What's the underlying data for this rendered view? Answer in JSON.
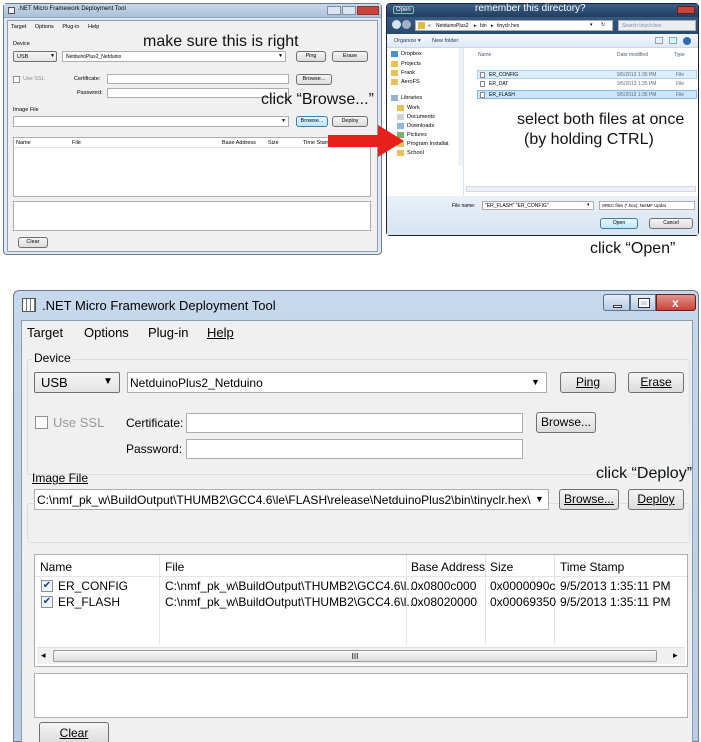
{
  "small_tool": {
    "title": ".NET Micro Framework Deployment Tool",
    "menu": [
      "Target",
      "Options",
      "Plug-in",
      "Help"
    ],
    "device_label": "Device",
    "transport": "USB",
    "device": "NetduinoPlus2_Netduino",
    "ping": "Ping",
    "erase": "Erase",
    "use_ssl": "Use SSL",
    "certificate_label": "Certificate:",
    "password_label": "Password:",
    "browse": "Browse...",
    "image_file_label": "Image File",
    "deploy": "Deploy",
    "columns": [
      "Name",
      "File",
      "Base Address",
      "Size",
      "Time Stamp"
    ],
    "clear": "Clear"
  },
  "open_dialog": {
    "title": "Open",
    "breadcrumb": [
      "NetduinoPlus2",
      "bin",
      "tinyclr.hex"
    ],
    "search_placeholder": "Search tinyclr.hex",
    "organize": "Organize ▾",
    "new_folder": "New folder",
    "nav_items": [
      "Dropbox",
      "Projects",
      "Frank",
      "AeroFS",
      "Libraries",
      "Work",
      "Documents",
      "Downloads",
      "Pictures",
      "Program Installat",
      "School"
    ],
    "columns": [
      "Name",
      "Date modified",
      "Type"
    ],
    "files": [
      {
        "name": "ER_CONFIG",
        "date": "9/5/2013 1:35 PM",
        "type": "File"
      },
      {
        "name": "ER_DAT",
        "date": "9/5/2013 1:35 PM",
        "type": "File"
      },
      {
        "name": "ER_FLASH",
        "date": "9/5/2013 1:35 PM",
        "type": "File"
      }
    ],
    "filename_label": "File name:",
    "filename_value": "\"ER_FLASH\" \"ER_CONFIG\"",
    "filetype": "SREC files (*.hex); NetMF Updat",
    "open": "Open",
    "cancel": "Cancel"
  },
  "annotations": {
    "make_sure": "make sure this is right",
    "click_browse": "click “Browse...”",
    "remember": "remember this directory?",
    "select_both_1": "select both files at once",
    "select_both_2": "(by holding CTRL)",
    "click_open": "click “Open”",
    "click_deploy": "click “Deploy”"
  },
  "main_tool": {
    "title": ".NET Micro Framework Deployment Tool",
    "menu": [
      "Target",
      "Options",
      "Plug-in",
      "Help"
    ],
    "device_label": "Device",
    "transport": "USB",
    "device": "NetduinoPlus2_Netduino",
    "ping": "Ping",
    "erase": "Erase",
    "use_ssl": "Use SSL",
    "certificate_label": "Certificate:",
    "password_label": "Password:",
    "image_file_label": "Image File",
    "image_path": "C:\\nmf_pk_w\\BuildOutput\\THUMB2\\GCC4.6\\le\\FLASH\\release\\NetduinoPlus2\\bin\\tinyclr.hex\\ER_",
    "browse": "Browse...",
    "deploy": "Deploy",
    "columns": [
      "Name",
      "File",
      "Base Address",
      "Size",
      "Time Stamp"
    ],
    "rows": [
      {
        "name": "ER_CONFIG",
        "file": "C:\\nmf_pk_w\\BuildOutput\\THUMB2\\GCC4.6\\l...",
        "base": "0x0800c000",
        "size": "0x0000090c",
        "stamp": "9/5/2013 1:35:11 PM"
      },
      {
        "name": "ER_FLASH",
        "file": "C:\\nmf_pk_w\\BuildOutput\\THUMB2\\GCC4.6\\l...",
        "base": "0x08020000",
        "size": "0x00069350",
        "stamp": "9/5/2013 1:35:11 PM"
      }
    ],
    "scroll_mark": "III",
    "clear": "Clear"
  },
  "colors": {
    "arrow": "#e8201c",
    "selection": "#cde8ff",
    "close_button": "#c9443a"
  }
}
